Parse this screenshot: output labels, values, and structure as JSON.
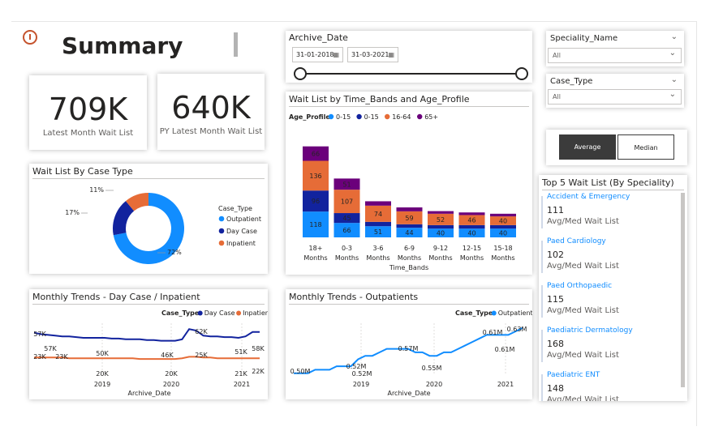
{
  "header": {
    "title": "Summary"
  },
  "kpis": [
    {
      "value": "709K",
      "label": "Latest Month Wait List"
    },
    {
      "value": "640K",
      "label": "PY Latest Month Wait List"
    }
  ],
  "archive_slicer": {
    "title": "Archive_Date",
    "start": "31-01-2018",
    "end": "31-03-2021"
  },
  "speciality_slicer": {
    "title": "Speciality_Name",
    "value": "All"
  },
  "casetype_slicer": {
    "title": "Case_Type",
    "value": "All"
  },
  "toggle": {
    "average": "Average",
    "median": "Median"
  },
  "donut": {
    "title": "Wait List By Case Type",
    "legend_title": "Case_Type",
    "chart_data": {
      "type": "pie",
      "categories": [
        "Outpatient",
        "Day Case",
        "Inpatient"
      ],
      "values": [
        72,
        17,
        11
      ],
      "labels": [
        "72%",
        "17%",
        "11%"
      ],
      "colors": [
        "#118dff",
        "#12239e",
        "#e66c37"
      ]
    }
  },
  "bar": {
    "title": "Wait List by Time_Bands and Age_Profile",
    "legend_title": "Age_Profile",
    "xlabel": "Time_Bands",
    "chart_data": {
      "type": "bar",
      "stacked": true,
      "categories": [
        [
          "18+",
          "Months"
        ],
        [
          "0-3",
          "Months"
        ],
        [
          "3-6",
          "Months"
        ],
        [
          "6-9",
          "Months"
        ],
        [
          "9-12",
          "Months"
        ],
        [
          "12-15",
          "Months"
        ],
        [
          "15-18",
          "Months"
        ]
      ],
      "series": [
        {
          "name": "0-15",
          "color": "#118dff",
          "values": [
            118,
            66,
            51,
            44,
            40,
            40,
            40
          ],
          "labels": [
            "118",
            "66",
            "51",
            "44",
            "40",
            "40",
            "40"
          ]
        },
        {
          "name": "0-15",
          "color": "#12239e",
          "values": [
            96,
            45,
            20,
            16,
            16,
            16,
            16
          ],
          "labels": [
            "96",
            "45",
            "",
            "",
            "",
            "",
            ""
          ]
        },
        {
          "name": "16-64",
          "color": "#e66c37",
          "values": [
            136,
            107,
            74,
            59,
            52,
            46,
            40
          ],
          "labels": [
            "136",
            "107",
            "74",
            "59",
            "52",
            "46",
            "40"
          ]
        },
        {
          "name": "65+",
          "color": "#6b007b",
          "values": [
            66,
            51,
            20,
            18,
            12,
            12,
            12
          ],
          "labels": [
            "66",
            "51",
            "",
            "",
            "",
            "",
            ""
          ]
        }
      ]
    }
  },
  "trend_daycase": {
    "title": "Monthly Trends - Day Case / Inpatient",
    "legend_title": "Case_Type",
    "xlabel": "Archive_Date",
    "x_ticks": [
      "2019",
      "2020",
      "2021"
    ],
    "chart_data": {
      "type": "line",
      "series": [
        {
          "name": "Day Case",
          "color": "#12239e",
          "values": [
            57,
            55,
            54,
            53,
            52,
            52,
            51,
            50,
            50,
            50,
            50,
            49,
            49,
            48,
            48,
            48,
            47,
            47,
            46,
            46,
            46,
            48,
            62,
            60,
            53,
            52,
            52,
            51,
            51,
            50,
            52,
            58,
            58
          ]
        },
        {
          "name": "Inpatient",
          "color": "#e66c37",
          "values": [
            23,
            23,
            23,
            23,
            23,
            22,
            22,
            22,
            22,
            22,
            22,
            22,
            22,
            22,
            22,
            21,
            21,
            21,
            21,
            21,
            21,
            22,
            24,
            24,
            23,
            23,
            22,
            22,
            22,
            22,
            22,
            22,
            22
          ]
        }
      ],
      "labels": [
        "57K",
        "57K",
        "23K",
        "23K",
        "50K",
        "20K",
        "46K",
        "20K",
        "62K",
        "25K",
        "51K",
        "21K",
        "58K",
        "22K"
      ]
    }
  },
  "trend_outpatient": {
    "title": "Monthly Trends - Outpatients",
    "legend_title": "Case_Type",
    "xlabel": "Archive_Date",
    "x_ticks": [
      "2019",
      "2020",
      "2021"
    ],
    "chart_data": {
      "type": "line",
      "series": [
        {
          "name": "Outpatient",
          "color": "#118dff",
          "values": [
            0.5,
            0.5,
            0.5,
            0.51,
            0.51,
            0.51,
            0.52,
            0.52,
            0.52,
            0.54,
            0.55,
            0.55,
            0.56,
            0.57,
            0.57,
            0.57,
            0.57,
            0.56,
            0.56,
            0.55,
            0.55,
            0.56,
            0.56,
            0.57,
            0.58,
            0.59,
            0.6,
            0.61,
            0.61,
            0.61,
            0.61,
            0.62,
            0.63
          ]
        }
      ],
      "labels": [
        "0.50M",
        "0.52M",
        "0.52M",
        "0.57M",
        "0.55M",
        "0.61M",
        "0.61M",
        "0.63M"
      ]
    }
  },
  "top5": {
    "title": "Top 5 Wait List (By Speciality)",
    "items": [
      {
        "name": "Accident & Emergency",
        "value": "111",
        "sub": "Avg/Med Wait List"
      },
      {
        "name": "Paed Cardiology",
        "value": "102",
        "sub": "Avg/Med Wait List"
      },
      {
        "name": "Paed Orthopaedic",
        "value": "115",
        "sub": "Avg/Med Wait List"
      },
      {
        "name": "Paediatric Dermatology",
        "value": "168",
        "sub": "Avg/Med Wait List"
      },
      {
        "name": "Paediatric ENT",
        "value": "148",
        "sub": "Avg/Med Wait List"
      }
    ]
  }
}
